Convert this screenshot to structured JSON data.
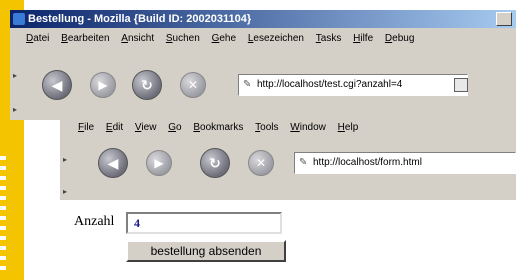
{
  "outer_window": {
    "title": "Bestellung - Mozilla {Build ID: 2002031104}",
    "menu": [
      "Datei",
      "Bearbeiten",
      "Ansicht",
      "Suchen",
      "Gehe",
      "Lesezeichen",
      "Tasks",
      "Hilfe",
      "Debug"
    ],
    "url": "http://localhost/test.cgi?anzahl=4"
  },
  "inner_window": {
    "menu": [
      "File",
      "Edit",
      "View",
      "Go",
      "Bookmarks",
      "Tools",
      "Window",
      "Help"
    ],
    "url": "http://localhost/form.html"
  },
  "form": {
    "label": "Anzahl",
    "value": "4",
    "submit_label": "bestellung absenden"
  },
  "colors": {
    "accent": "#f5c400",
    "titlebar": "#0a246a"
  }
}
